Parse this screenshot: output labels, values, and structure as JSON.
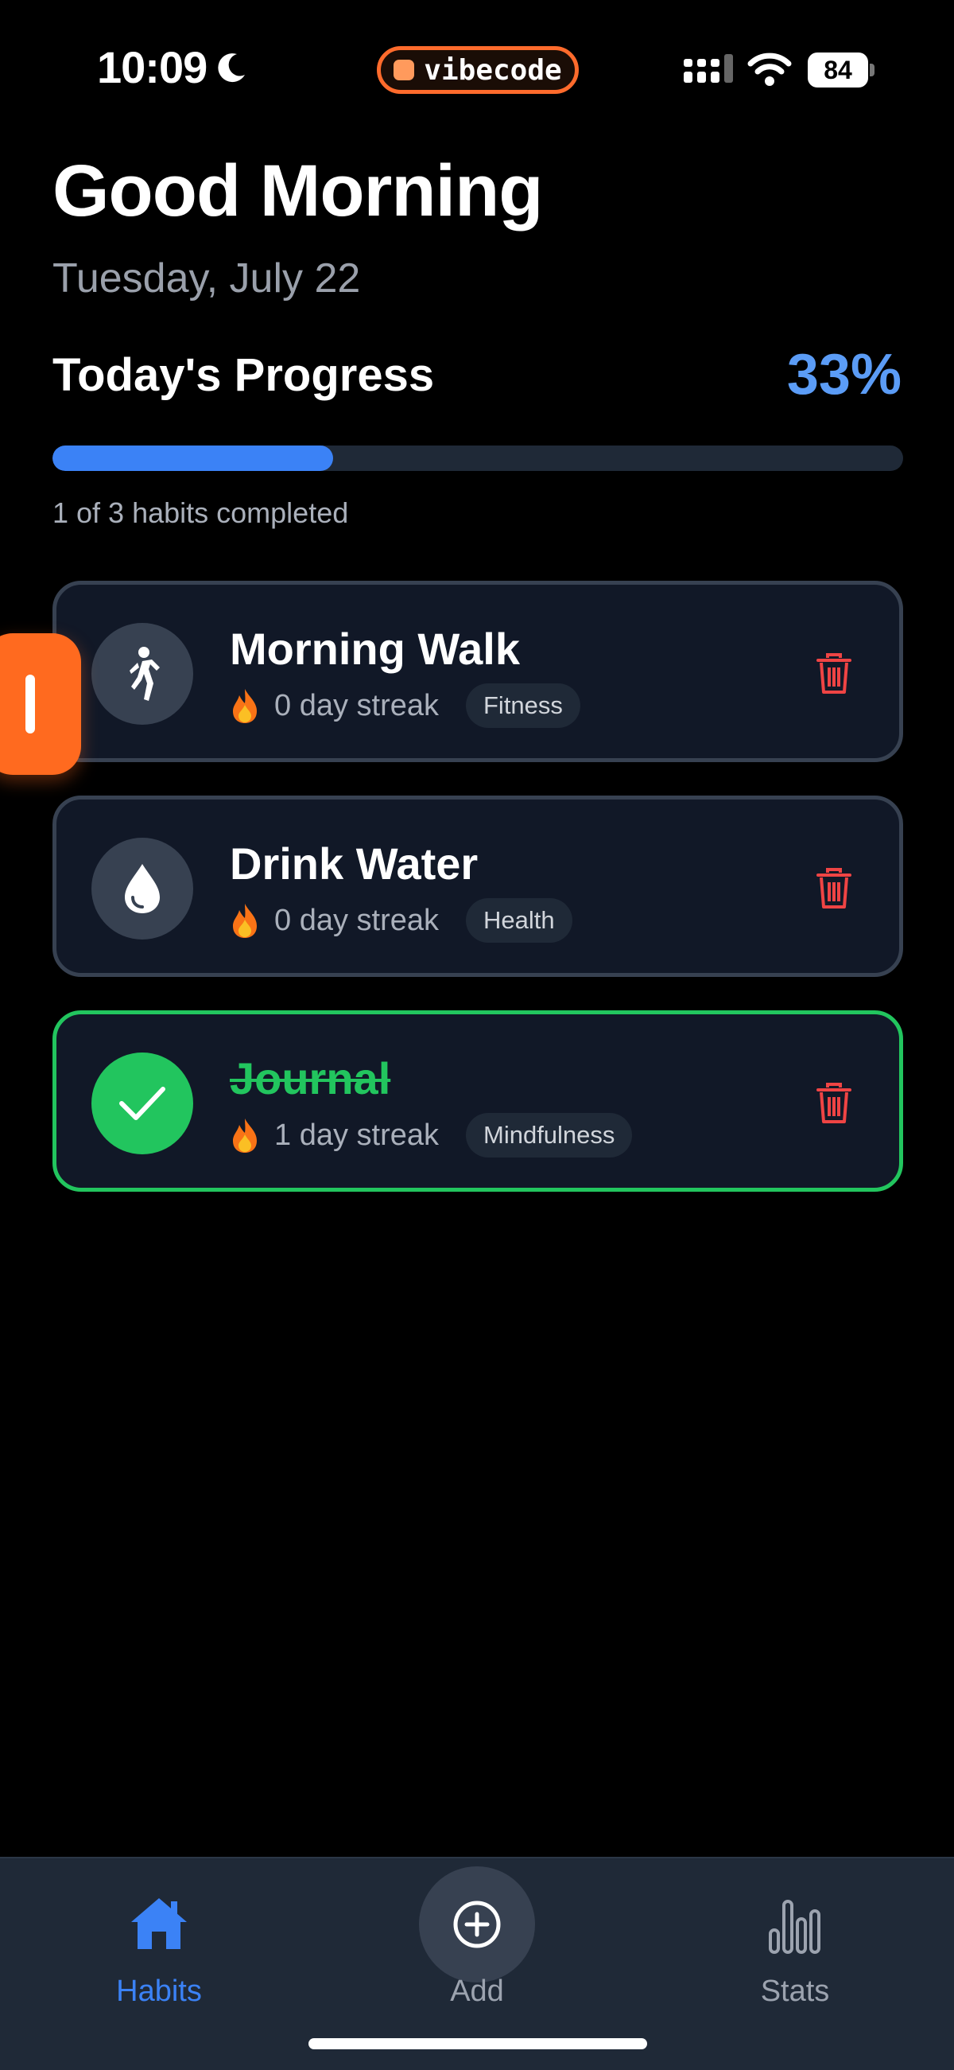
{
  "status_bar": {
    "time": "10:09",
    "app_pill": "vibecode",
    "battery": "84"
  },
  "header": {
    "greeting": "Good Morning",
    "date": "Tuesday, July 22"
  },
  "progress": {
    "title": "Today's Progress",
    "percent_label": "33%",
    "fraction": 0.33,
    "caption": "1 of 3 habits completed"
  },
  "habits": [
    {
      "title": "Morning Walk",
      "streak": "0 day streak",
      "category": "Fitness",
      "icon": "walking-person-icon",
      "completed": false
    },
    {
      "title": "Drink Water",
      "streak": "0 day streak",
      "category": "Health",
      "icon": "water-drop-icon",
      "completed": false
    },
    {
      "title": "Journal",
      "streak": "1 day streak",
      "category": "Mindfulness",
      "icon": "checkmark-icon",
      "completed": true
    }
  ],
  "tabbar": {
    "habits": "Habits",
    "add": "Add",
    "stats": "Stats"
  },
  "colors": {
    "accent_blue": "#3b82f6",
    "success_green": "#22c55e",
    "danger_red": "#ef4444",
    "vibecode_orange": "#ff6a1f"
  }
}
